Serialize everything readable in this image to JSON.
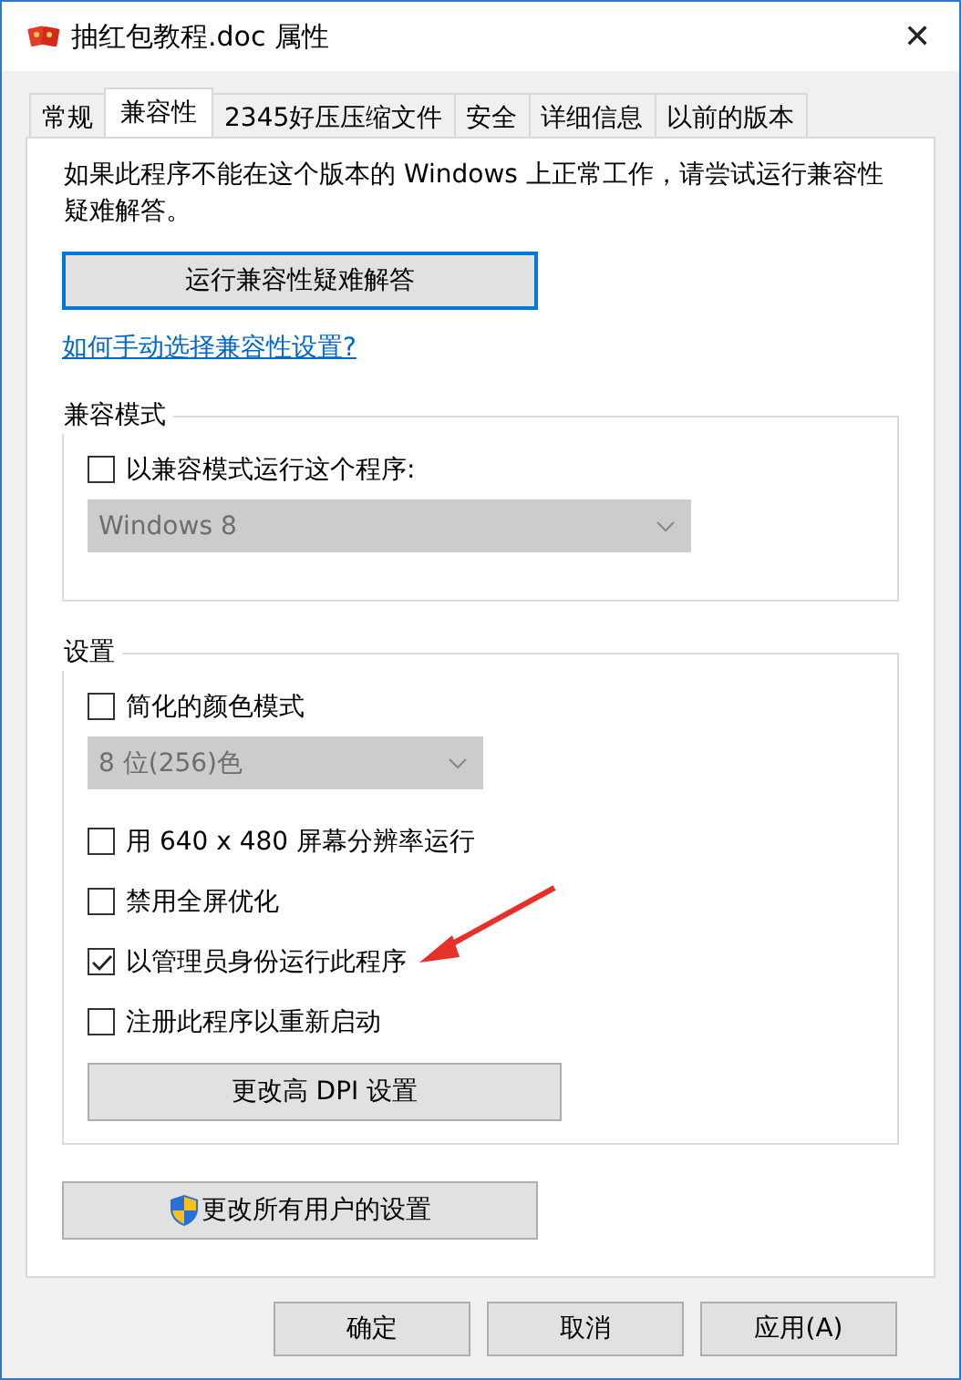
{
  "window": {
    "title": "抽红包教程.doc 属性",
    "close": "✕"
  },
  "tabs": [
    {
      "label": "常规",
      "selected": false
    },
    {
      "label": "兼容性",
      "selected": true
    },
    {
      "label": "2345好压压缩文件",
      "selected": false
    },
    {
      "label": "安全",
      "selected": false
    },
    {
      "label": "详细信息",
      "selected": false
    },
    {
      "label": "以前的版本",
      "selected": false
    }
  ],
  "intro": "如果此程序不能在这个版本的 Windows 上正常工作，请尝试运行兼容性疑难解答。",
  "troubleshoot_button": "运行兼容性疑难解答",
  "help_link": "如何手动选择兼容性设置?",
  "groups": [
    {
      "title": "兼容模式",
      "items": [
        {
          "kind": "checkbox",
          "label": "以兼容模式运行这个程序:",
          "checked": false
        },
        {
          "kind": "dropdown",
          "value": "Windows 8",
          "disabled": true
        }
      ]
    },
    {
      "title": "设置",
      "items": [
        {
          "kind": "checkbox",
          "label": "简化的颜色模式",
          "checked": false
        },
        {
          "kind": "dropdown",
          "value": "8 位(256)色",
          "disabled": true
        },
        {
          "kind": "checkbox",
          "label": "用 640 x 480 屏幕分辨率运行",
          "checked": false
        },
        {
          "kind": "checkbox",
          "label": "禁用全屏优化",
          "checked": false
        },
        {
          "kind": "checkbox",
          "label": "以管理员身份运行此程序",
          "checked": true
        },
        {
          "kind": "checkbox",
          "label": "注册此程序以重新启动",
          "checked": false
        },
        {
          "kind": "button",
          "label": "更改高 DPI 设置"
        }
      ]
    }
  ],
  "all_users_button": "更改所有用户的设置",
  "buttons": [
    "确定",
    "取消",
    "应用(A)"
  ]
}
